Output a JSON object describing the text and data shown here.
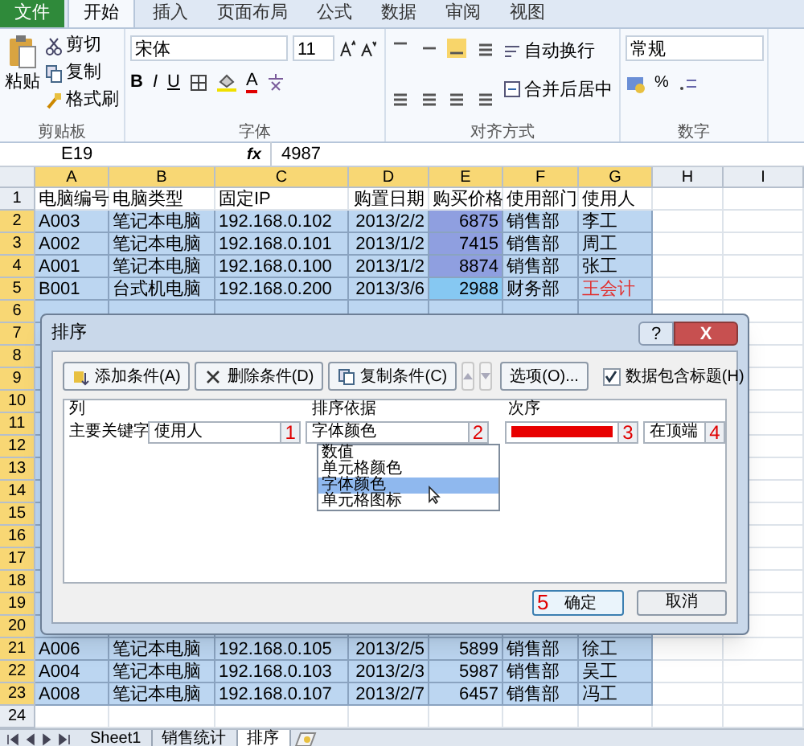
{
  "ribbon_tabs": [
    {
      "label": "文件",
      "kind": "file",
      "selected": false
    },
    {
      "label": "开始",
      "kind": "tab",
      "selected": true
    },
    {
      "label": "插入",
      "kind": "tab",
      "selected": false
    },
    {
      "label": "页面布局",
      "kind": "tab",
      "selected": false
    },
    {
      "label": "公式",
      "kind": "tab",
      "selected": false
    },
    {
      "label": "数据",
      "kind": "tab",
      "selected": false
    },
    {
      "label": "审阅",
      "kind": "tab",
      "selected": false
    },
    {
      "label": "视图",
      "kind": "tab",
      "selected": false
    }
  ],
  "clipboard": {
    "paste": "粘贴",
    "cut": "剪切",
    "copy": "复制",
    "format_painter": "格式刷",
    "label": "剪贴板"
  },
  "font": {
    "name": "宋体",
    "size": "11",
    "bold": "B",
    "italic": "I",
    "underline": "U",
    "color_letter": "A",
    "label": "字体"
  },
  "alignment": {
    "wrap": "自动换行",
    "merge": "合并后居中",
    "label": "对齐方式"
  },
  "number": {
    "format": "常规",
    "percent": "%",
    "label": "数字"
  },
  "formula_bar": {
    "name_box": "E19",
    "fx": "fx",
    "value": "4987"
  },
  "columns": [
    "A",
    "B",
    "C",
    "D",
    "E",
    "F",
    "G",
    "H",
    "I"
  ],
  "row_numbers": [
    "1",
    "2",
    "3",
    "4",
    "5",
    "6",
    "7",
    "8",
    "9",
    "10",
    "11",
    "12",
    "13",
    "14",
    "15",
    "16",
    "17",
    "18",
    "19",
    "20",
    "21",
    "22",
    "23",
    "24"
  ],
  "header_row": [
    "电脑编号",
    "电脑类型",
    "固定IP",
    "购置日期",
    "购买价格",
    "使用部门",
    "使用人"
  ],
  "rows_top": [
    {
      "cells": [
        "A003",
        "笔记本电脑",
        "192.168.0.102",
        "2013/2/2",
        {
          "text": "6875",
          "color": "#8f9fe0"
        },
        "销售部",
        {
          "text": "李工",
          "color": "#000000"
        }
      ]
    },
    {
      "cells": [
        "A002",
        "笔记本电脑",
        "192.168.0.101",
        "2013/1/2",
        {
          "text": "7415",
          "color": "#8f9fe0"
        },
        "销售部",
        {
          "text": "周工",
          "color": "#000000"
        }
      ]
    },
    {
      "cells": [
        "A001",
        "笔记本电脑",
        "192.168.0.100",
        "2013/1/2",
        {
          "text": "8874",
          "color": "#8f9fe0"
        },
        "销售部",
        {
          "text": "张工",
          "color": "#000000"
        }
      ]
    },
    {
      "cells": [
        "B001",
        "台式机电脑",
        "192.168.0.200",
        "2013/3/6",
        {
          "text": "2988",
          "color": "#86c8f2"
        },
        "财务部",
        {
          "text": "王会计",
          "color": "#e03030"
        }
      ]
    }
  ],
  "rows_bottom": [
    {
      "cells": [
        "A006",
        "笔记本电脑",
        "192.168.0.105",
        "2013/2/5",
        {
          "text": "5899",
          "color": "#bcd6f1"
        },
        "销售部",
        {
          "text": "徐工",
          "color": "#000000"
        }
      ]
    },
    {
      "cells": [
        "A004",
        "笔记本电脑",
        "192.168.0.103",
        "2013/2/3",
        {
          "text": "5987",
          "color": "#bcd6f1"
        },
        "销售部",
        {
          "text": "吴工",
          "color": "#000000"
        }
      ]
    },
    {
      "cells": [
        "A008",
        "笔记本电脑",
        "192.168.0.107",
        "2013/2/7",
        {
          "text": "6457",
          "color": "#bcd6f1"
        },
        "销售部",
        {
          "text": "冯工",
          "color": "#000000"
        }
      ]
    }
  ],
  "sheet_tabs": [
    {
      "label": "Sheet1",
      "selected": false
    },
    {
      "label": "销售统计",
      "selected": false
    },
    {
      "label": "排序",
      "selected": true
    }
  ],
  "dialog": {
    "title": "排序",
    "help": "?",
    "close": "X",
    "toolbar": [
      {
        "label": "添加条件(A)",
        "kind": "add",
        "disabled": false
      },
      {
        "label": "删除条件(D)",
        "kind": "delete",
        "disabled": false
      },
      {
        "label": "复制条件(C)",
        "kind": "copy",
        "disabled": false
      },
      {
        "kind": "up",
        "disabled": true
      },
      {
        "kind": "down",
        "disabled": true
      },
      {
        "label": "选项(O)...",
        "kind": "options",
        "disabled": false
      }
    ],
    "has_headers": {
      "label": "数据包含标题(H)",
      "checked": true
    },
    "column_headers": [
      "列",
      "排序依据",
      "次序"
    ],
    "level": {
      "label": "主要关键字",
      "column": "使用人",
      "sort_on": "字体颜色",
      "color": "#e80000",
      "order": "在顶端",
      "marks": [
        "1",
        "2",
        "3",
        "4"
      ]
    },
    "sort_on_options": [
      {
        "label": "数值",
        "selected": false
      },
      {
        "label": "单元格颜色",
        "selected": false
      },
      {
        "label": "字体颜色",
        "selected": true
      },
      {
        "label": "单元格图标",
        "selected": false
      }
    ],
    "ok": {
      "label": "确定",
      "mark": "5"
    },
    "cancel": "取消"
  }
}
